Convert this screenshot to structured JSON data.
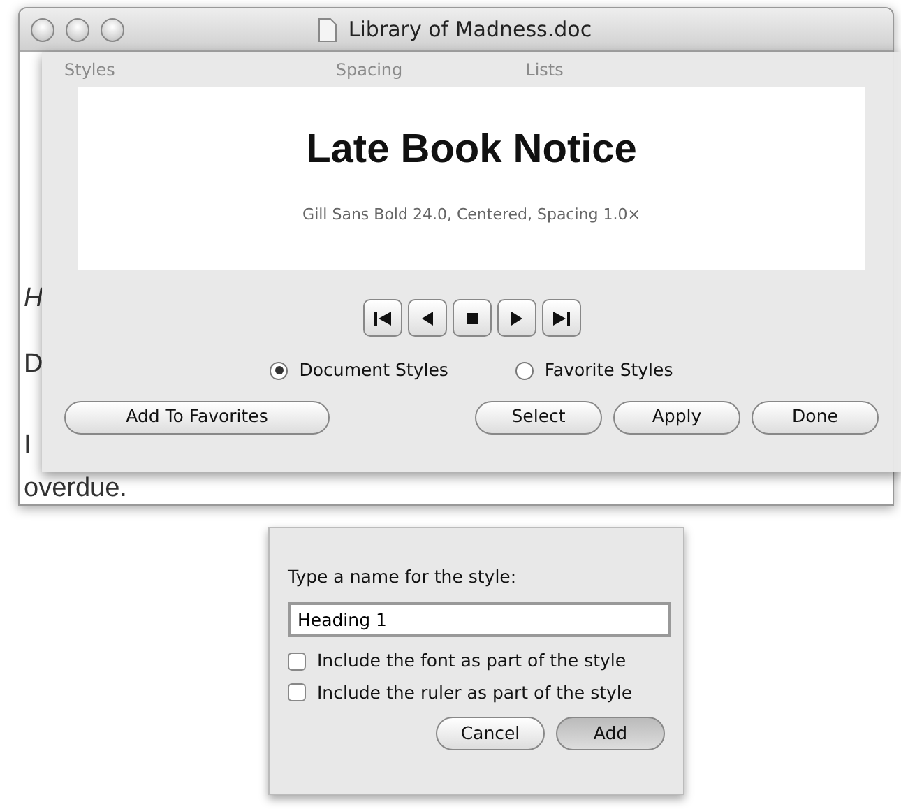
{
  "window": {
    "title": "Library of Madness.doc",
    "toolbar": [
      "Styles",
      "Spacing",
      "Lists"
    ],
    "document_text": [
      "H",
      "D",
      "I",
      "overdue."
    ]
  },
  "styles_panel": {
    "preview_title": "Late Book Notice",
    "preview_description": "Gill Sans Bold 24.0, Centered, Spacing 1.0×",
    "transport": [
      {
        "kind": "first"
      },
      {
        "kind": "prev"
      },
      {
        "kind": "stop"
      },
      {
        "kind": "next"
      },
      {
        "kind": "last"
      }
    ],
    "options": [
      {
        "label": "Document Styles",
        "selected": true
      },
      {
        "label": "Favorite Styles",
        "selected": false
      }
    ],
    "buttons": [
      {
        "label": "Add To Favorites",
        "default": false
      },
      {
        "label": "Select",
        "default": false
      },
      {
        "label": "Apply",
        "default": false
      },
      {
        "label": "Done",
        "default": false
      }
    ]
  },
  "name_dialog": {
    "prompt": "Type a name for the style:",
    "value": "Heading 1",
    "checkboxes": [
      {
        "label": "Include the font as part of the style",
        "checked": false
      },
      {
        "label": "Include the ruler as part of the style",
        "checked": false
      }
    ],
    "buttons": [
      {
        "label": "Cancel",
        "default": false
      },
      {
        "label": "Add",
        "default": true
      }
    ]
  }
}
